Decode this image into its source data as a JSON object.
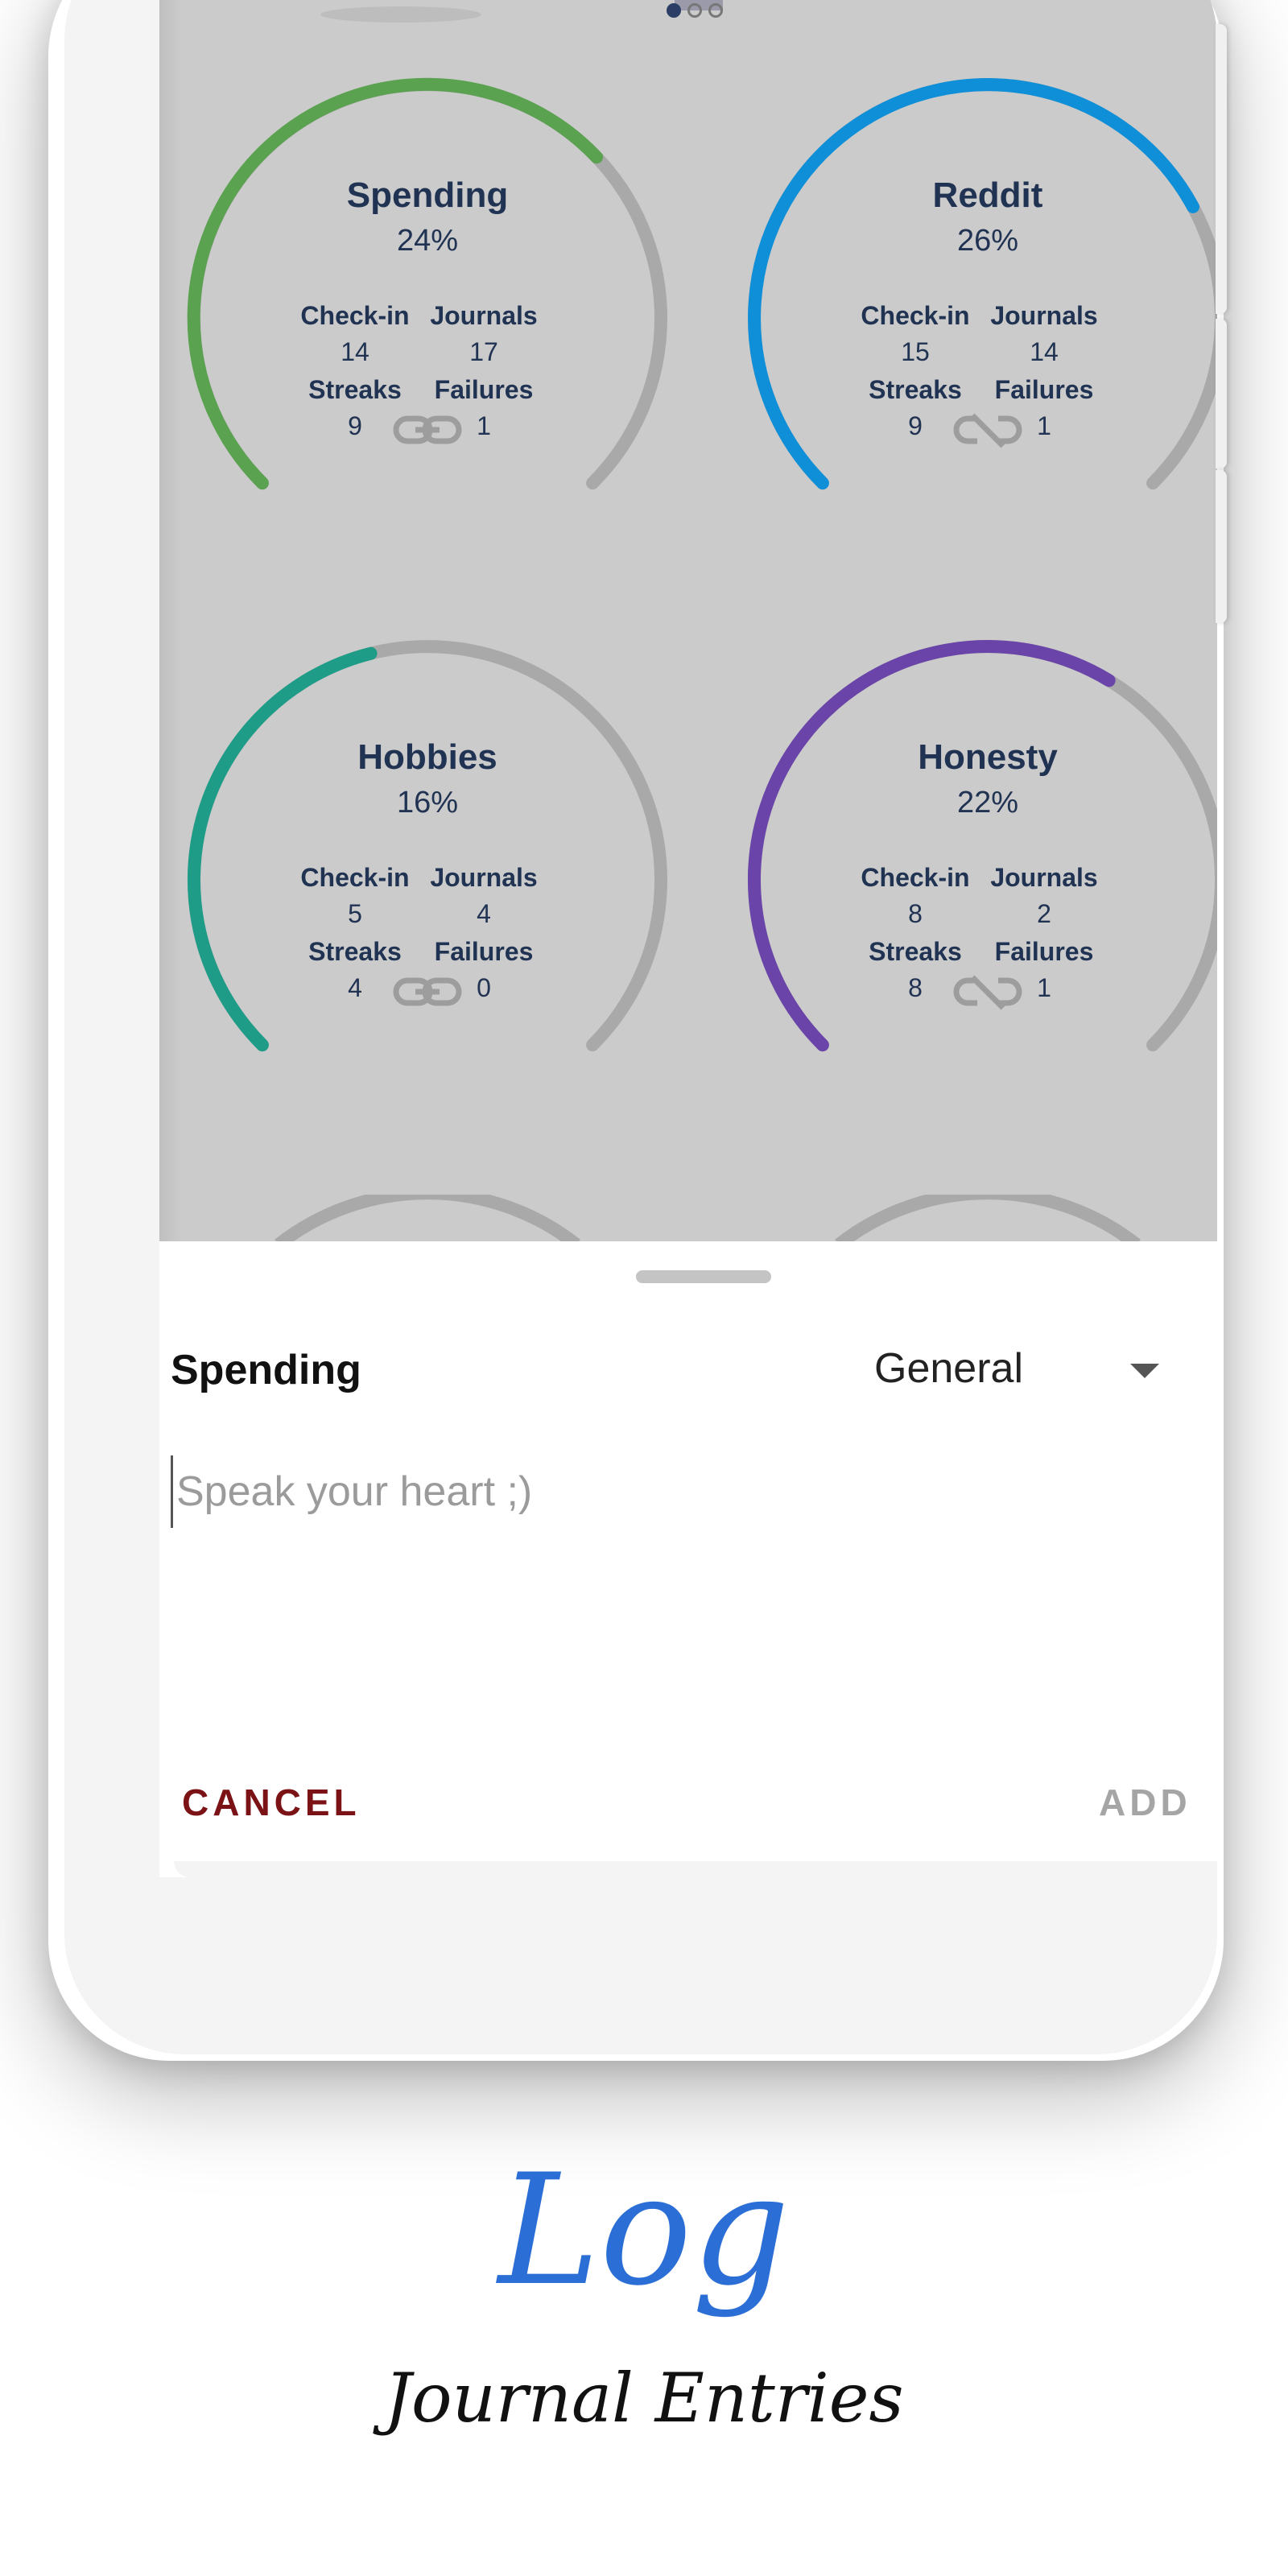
{
  "onboarding": {
    "page_index": 1,
    "page_count": 3
  },
  "habits": [
    {
      "name": "Spending",
      "percent": "24%",
      "progress": 0.24,
      "color": "#5aa150",
      "linked": true,
      "stats": {
        "checkin_label": "Check-in",
        "checkin": "14",
        "journals_label": "Journals",
        "journals": "17",
        "streaks_label": "Streaks",
        "streaks": "9",
        "failures_label": "Failures",
        "failures": "1"
      }
    },
    {
      "name": "Reddit",
      "percent": "26%",
      "progress": 0.26,
      "color": "#0e8fd8",
      "linked": false,
      "stats": {
        "checkin_label": "Check-in",
        "checkin": "15",
        "journals_label": "Journals",
        "journals": "14",
        "streaks_label": "Streaks",
        "streaks": "9",
        "failures_label": "Failures",
        "failures": "1"
      }
    },
    {
      "name": "Hobbies",
      "percent": "16%",
      "progress": 0.16,
      "color": "#1f9c88",
      "linked": true,
      "stats": {
        "checkin_label": "Check-in",
        "checkin": "5",
        "journals_label": "Journals",
        "journals": "4",
        "streaks_label": "Streaks",
        "streaks": "4",
        "failures_label": "Failures",
        "failures": "0"
      }
    },
    {
      "name": "Honesty",
      "percent": "22%",
      "progress": 0.22,
      "color": "#6a44a8",
      "linked": false,
      "stats": {
        "checkin_label": "Check-in",
        "checkin": "8",
        "journals_label": "Journals",
        "journals": "2",
        "streaks_label": "Streaks",
        "streaks": "8",
        "failures_label": "Failures",
        "failures": "1"
      }
    }
  ],
  "sheet": {
    "habit_name": "Spending",
    "category": "General",
    "entry_placeholder": "Speak your heart ;)",
    "cancel_label": "CANCEL",
    "add_label": "ADD"
  },
  "caption": {
    "title": "Log",
    "subtitle": "Journal Entries"
  },
  "colors": {
    "gauge_track": "#a9a9a9",
    "text_navy": "#213353",
    "cancel": "#7b1215",
    "add_disabled": "#a5a5a5",
    "title_blue": "#2b6ed6"
  }
}
